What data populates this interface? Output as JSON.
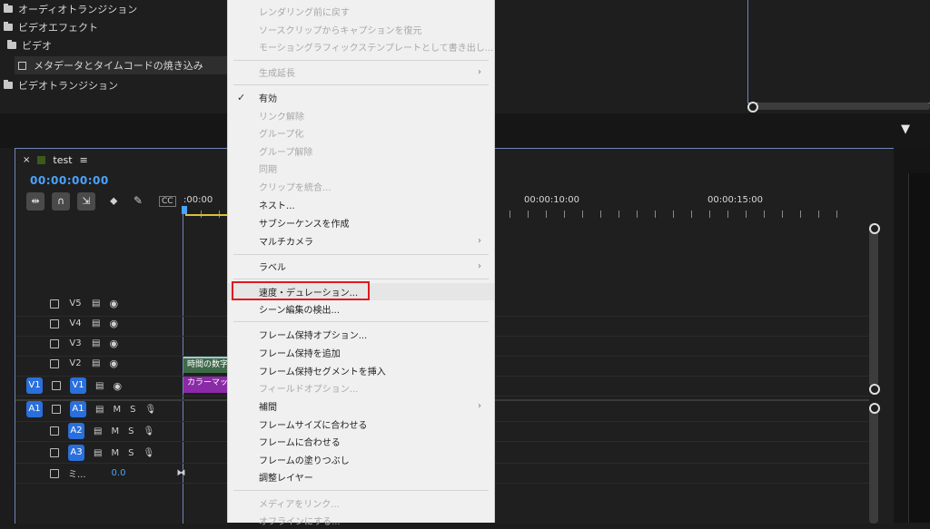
{
  "effects_panel": {
    "items": [
      {
        "label": "オーディオトランジション",
        "type": "folder"
      },
      {
        "label": "ビデオエフェクト",
        "type": "folder"
      },
      {
        "label": "ビデオ",
        "type": "folder"
      },
      {
        "label": "メタデータとタイムコードの焼き込み",
        "type": "effect"
      },
      {
        "label": "ビデオトランジション",
        "type": "folder"
      }
    ]
  },
  "timeline": {
    "sequence_name": "test",
    "timecode": "00:00:00:00",
    "ruler": [
      ":00:00",
      "00:00:10:00",
      "00:00:15:00"
    ],
    "tracks": [
      {
        "name": "V5",
        "kind": "video"
      },
      {
        "name": "V4",
        "kind": "video"
      },
      {
        "name": "V3",
        "kind": "video"
      },
      {
        "name": "V2",
        "kind": "video"
      },
      {
        "name": "V1",
        "kind": "video",
        "source": "V1"
      },
      {
        "name": "A1",
        "kind": "audio",
        "source": "A1"
      },
      {
        "name": "A2",
        "kind": "audio"
      },
      {
        "name": "A3",
        "kind": "audio"
      },
      {
        "name": "ミ...",
        "kind": "master",
        "value": "0.0"
      }
    ],
    "audio_m": "M",
    "audio_s": "S",
    "clips": {
      "v2": "時間の数字",
      "v1": "カラーマット"
    }
  },
  "context_menu": {
    "items": [
      {
        "label": "レンダリング前に戻す",
        "disabled": true
      },
      {
        "label": "ソースクリップからキャプションを復元",
        "disabled": true
      },
      {
        "label": "モーショングラフィックステンプレートとして書き出し...",
        "disabled": true
      },
      {
        "label": "生成延長",
        "disabled": true,
        "submenu": true
      },
      {
        "label": "有効",
        "disabled": false,
        "checked": true
      },
      {
        "label": "リンク解除",
        "disabled": true
      },
      {
        "label": "グループ化",
        "disabled": true
      },
      {
        "label": "グループ解除",
        "disabled": true
      },
      {
        "label": "同期",
        "disabled": true
      },
      {
        "label": "クリップを統合...",
        "disabled": true
      },
      {
        "label": "ネスト...",
        "disabled": false
      },
      {
        "label": "サブシーケンスを作成",
        "disabled": false
      },
      {
        "label": "マルチカメラ",
        "disabled": false,
        "submenu": true
      },
      {
        "label": "ラベル",
        "disabled": false,
        "submenu": true
      },
      {
        "label": "速度・デュレーション...",
        "disabled": false,
        "highlighted": true
      },
      {
        "label": "シーン編集の検出...",
        "disabled": false
      },
      {
        "label": "フレーム保持オプション...",
        "disabled": false
      },
      {
        "label": "フレーム保持を追加",
        "disabled": false
      },
      {
        "label": "フレーム保持セグメントを挿入",
        "disabled": false
      },
      {
        "label": "フィールドオプション...",
        "disabled": true
      },
      {
        "label": "補間",
        "disabled": false,
        "submenu": true
      },
      {
        "label": "フレームサイズに合わせる",
        "disabled": false
      },
      {
        "label": "フレームに合わせる",
        "disabled": false
      },
      {
        "label": "フレームの塗りつぶし",
        "disabled": false
      },
      {
        "label": "調整レイヤー",
        "disabled": false
      },
      {
        "label": "メディアをリンク...",
        "disabled": true
      },
      {
        "label": "オフラインにする...",
        "disabled": true
      }
    ]
  },
  "colors": {
    "accent_blue": "#2a6fdb",
    "highlight_red": "#e0191e",
    "timecode_blue": "#4aa3ff"
  }
}
